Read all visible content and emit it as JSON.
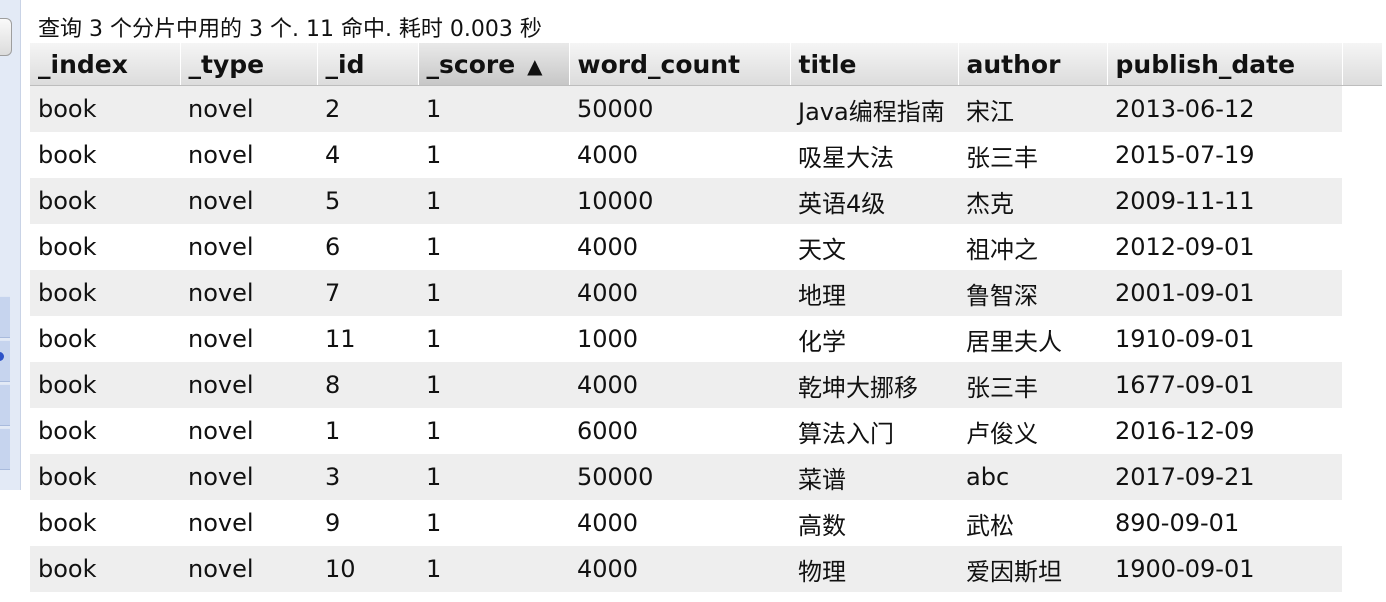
{
  "summary": "查询 3 个分片中用的 3 个. 11 命中. 耗时 0.003 秒",
  "columns": [
    {
      "label": "_index"
    },
    {
      "label": "_type"
    },
    {
      "label": "_id"
    },
    {
      "label": "_score",
      "sort_indicator": "▲"
    },
    {
      "label": "word_count"
    },
    {
      "label": "title"
    },
    {
      "label": "author"
    },
    {
      "label": "publish_date"
    }
  ],
  "rows": [
    [
      "book",
      "novel",
      "2",
      "1",
      "50000",
      "Java编程指南",
      "宋江",
      "2013-06-12"
    ],
    [
      "book",
      "novel",
      "4",
      "1",
      "4000",
      "吸星大法",
      "张三丰",
      "2015-07-19"
    ],
    [
      "book",
      "novel",
      "5",
      "1",
      "10000",
      "英语4级",
      "杰克",
      "2009-11-11"
    ],
    [
      "book",
      "novel",
      "6",
      "1",
      "4000",
      "天文",
      "祖冲之",
      "2012-09-01"
    ],
    [
      "book",
      "novel",
      "7",
      "1",
      "4000",
      "地理",
      "鲁智深",
      "2001-09-01"
    ],
    [
      "book",
      "novel",
      "11",
      "1",
      "1000",
      "化学",
      "居里夫人",
      "1910-09-01"
    ],
    [
      "book",
      "novel",
      "8",
      "1",
      "4000",
      "乾坤大挪移",
      "张三丰",
      "1677-09-01"
    ],
    [
      "book",
      "novel",
      "1",
      "1",
      "6000",
      "算法入门",
      "卢俊义",
      "2016-12-09"
    ],
    [
      "book",
      "novel",
      "3",
      "1",
      "50000",
      "菜谱",
      "abc",
      "2017-09-21"
    ],
    [
      "book",
      "novel",
      "9",
      "1",
      "4000",
      "高数",
      "武松",
      "890-09-01"
    ],
    [
      "book",
      "novel",
      "10",
      "1",
      "4000",
      "物理",
      "爱因斯坦",
      "1900-09-01"
    ]
  ]
}
